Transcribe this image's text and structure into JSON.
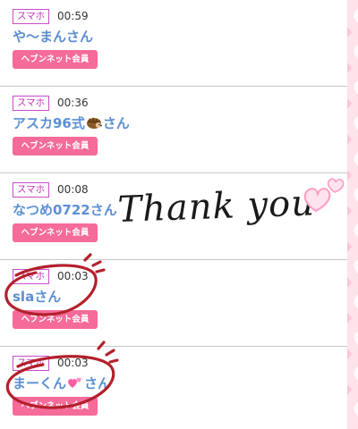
{
  "entries": [
    {
      "device": "スマホ",
      "time": "00:59",
      "name": "や～まんさん",
      "button": "ヘブンネット会員"
    },
    {
      "device": "スマホ",
      "time": "00:36",
      "name_before": "アスカ96式",
      "name_emoji": "hedgehog-emoji",
      "name_after": "さん",
      "button": "ヘブンネット会員"
    },
    {
      "device": "スマホ",
      "time": "00:08",
      "name": "なつめ0722さん",
      "button": "ヘブンネット会員"
    },
    {
      "device": "スマホ",
      "time": "00:03",
      "name": "slaさん",
      "button": "ヘブンネット会員"
    },
    {
      "device": "スマホ",
      "time": "00:03",
      "name_before": "まーくん",
      "name_emoji": "two-hearts-emoji",
      "name_after": "さん",
      "button": "ヘブンネット会員"
    }
  ],
  "handwriting": {
    "text": "Thank you"
  },
  "colors": {
    "badge_border": "#c94cc9",
    "name_blue": "#5b8fd4",
    "button_pink": "#f56b9a",
    "circle_red": "#b3202b",
    "divider": "#c7c7c7"
  }
}
